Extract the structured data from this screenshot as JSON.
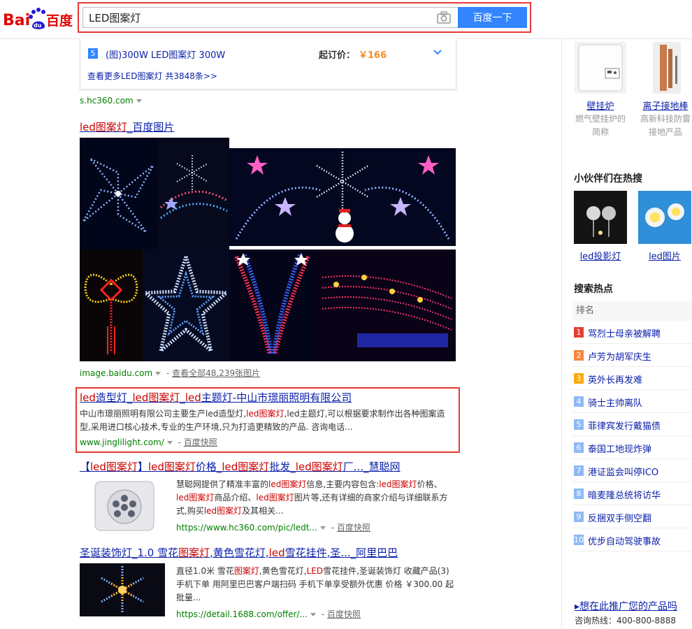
{
  "search": {
    "query": "LED图案灯",
    "button": "百度一下"
  },
  "ad": {
    "num": "5",
    "title": "(图)300W LED图案灯 300W",
    "price_label": "起订价：",
    "price": "￥166",
    "more": "查看更多LED图案灯 共3848条>>",
    "url": "s.hc360.com"
  },
  "image_result": {
    "title_em": "led图案灯",
    "title_rest": "_百度图片",
    "url": "image.baidu.com",
    "sep": " - ",
    "all_link": "查看全部48,239张图片"
  },
  "result1": {
    "title_parts": [
      "led",
      "造型灯_",
      "led图案灯",
      "_",
      "led",
      "主题灯-中山市璟丽照明有限公司"
    ],
    "abs_parts": [
      "中山市璟丽照明有限公司主要生产led造型灯,",
      "led图案灯",
      ",led主题灯,可以根据要求制作出各种图案造型,采用进口核心技术,专业的生产环境,只为打造更精致的产品. 咨询电话..."
    ],
    "url": "www.jinglilight.com/",
    "snap": "百度快照"
  },
  "result2": {
    "title_parts": [
      "【",
      "led图案灯",
      "】",
      "led图案灯",
      "价格_",
      "led图案灯",
      "批发_",
      "led图案灯",
      "厂..._慧聪网"
    ],
    "abs_parts": [
      "慧聪网提供了精准丰富的",
      "led图案灯",
      "信息,主要内容包含:",
      "led图案灯",
      "价格、",
      "led图案灯",
      "商品介绍、",
      "led图案灯",
      "图片等,还有详细的商家介绍与详细联系方式,购买",
      "led图案灯",
      "及其相关..."
    ],
    "url": "https://www.hc360.com/pic/ledt...",
    "snap": "百度快照"
  },
  "result3": {
    "title_parts": [
      "圣诞装饰灯_1.0 雪花",
      "图案灯",
      ",黄色雪花灯,",
      "led",
      "雪花挂件,圣..._阿里巴巴"
    ],
    "abs_parts": [
      "直径1.0米 雪花",
      "图案灯",
      ",黄色雪花灯,",
      "LED",
      "雪花挂件,圣诞装饰灯 收藏产品(3) 手机下单 用阿里巴巴客户端扫码 手机下单享受额外优惠 价格 ￥300.00 起批量..."
    ],
    "url": "https://detail.1688.com/offer/...",
    "snap": "百度快照"
  },
  "right": {
    "items": [
      {
        "caption": "壁挂炉",
        "sub": "燃气壁挂炉的简称"
      },
      {
        "caption": "离子接地棒",
        "sub": "高新科技防雷接地产品"
      }
    ],
    "partner_title": "小伙伴们在热搜",
    "partner_items": [
      {
        "caption": "led投影灯"
      },
      {
        "caption": "led图片"
      }
    ],
    "hot_title": "搜索热点",
    "hot_head": "排名",
    "hot": [
      {
        "num": "1",
        "text": "骂烈士母亲被解聘",
        "color": "#e33e33"
      },
      {
        "num": "2",
        "text": "卢芳为胡军庆生",
        "color": "#f5863e"
      },
      {
        "num": "3",
        "text": "英外长再发难",
        "color": "#faa90e"
      },
      {
        "num": "4",
        "text": "骑士主帅离队",
        "color": "#8eb9f5"
      },
      {
        "num": "5",
        "text": "菲律宾发行戴猫债",
        "color": "#8eb9f5"
      },
      {
        "num": "6",
        "text": "泰国工地现炸弹",
        "color": "#8eb9f5"
      },
      {
        "num": "7",
        "text": "港证监会叫停ICO",
        "color": "#8eb9f5"
      },
      {
        "num": "8",
        "text": "暗麦隆总统将访华",
        "color": "#8eb9f5"
      },
      {
        "num": "9",
        "text": "反捆双手侧空翻",
        "color": "#8eb9f5"
      },
      {
        "num": "10",
        "text": "优步自动驾驶事故",
        "color": "#8eb9f5"
      }
    ],
    "promo": "▸想在此推广您的产品吗",
    "hotline": "咨询热线：400-800-8888"
  }
}
